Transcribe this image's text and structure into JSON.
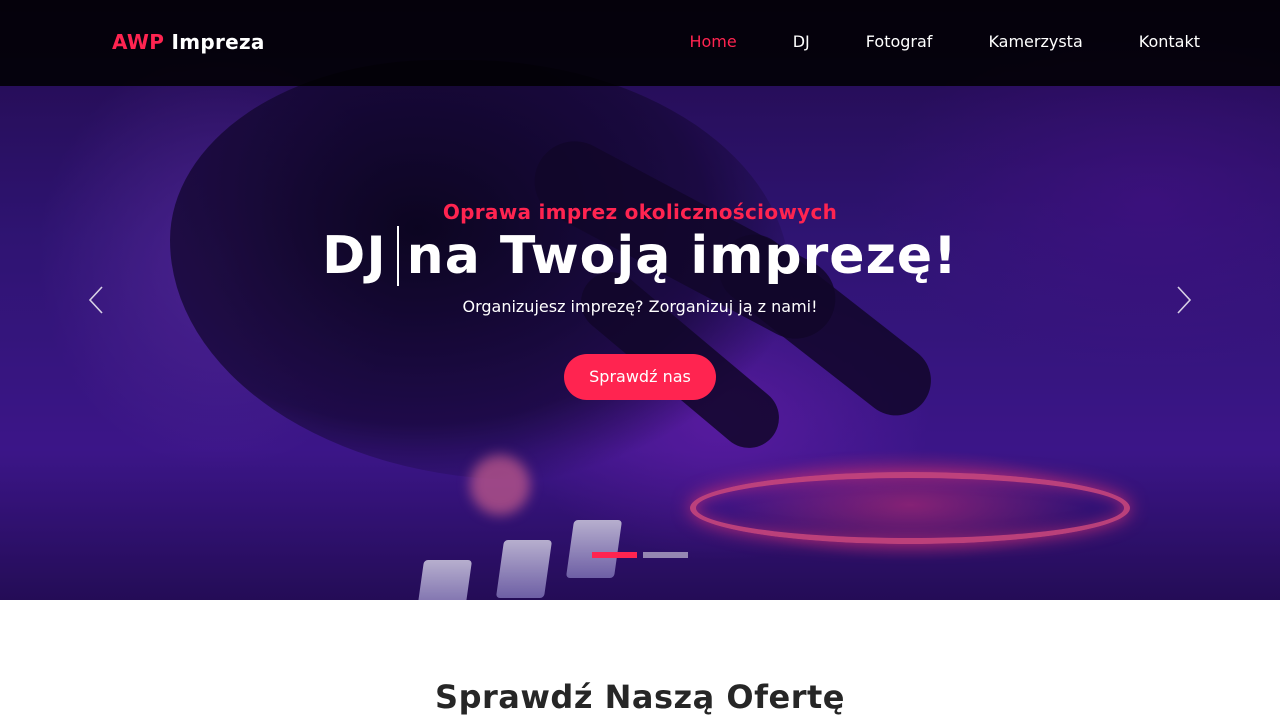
{
  "brand": {
    "accent": "AWP",
    "name": "Impreza",
    "accent_color": "#ff2450"
  },
  "nav": {
    "items": [
      {
        "label": "Home",
        "active": true
      },
      {
        "label": "DJ",
        "active": false
      },
      {
        "label": "Fotograf",
        "active": false
      },
      {
        "label": "Kamerzysta",
        "active": false
      },
      {
        "label": "Kontakt",
        "active": false
      }
    ]
  },
  "hero": {
    "subtitle": "Oprawa imprez okolicznościowych",
    "headline_typed": "DJ",
    "headline_rest": "na Twoją imprezę!",
    "lead": "Organizujesz imprezę? Zorganizuj ją z nami!",
    "cta_label": "Sprawdź nas",
    "prev_icon": "chevron-left-icon",
    "next_icon": "chevron-right-icon",
    "slides_count": 2,
    "active_slide": 1
  },
  "offer": {
    "title": "Sprawdź Naszą Ofertę"
  }
}
